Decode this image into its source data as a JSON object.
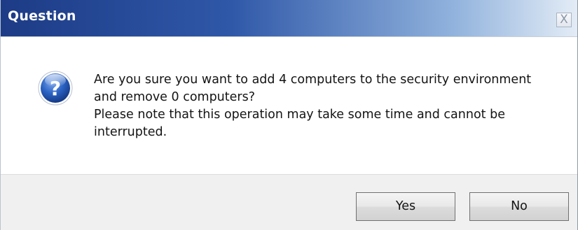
{
  "window": {
    "title": "Question",
    "close_label": "X"
  },
  "message": {
    "line1": "Are you sure you want to add 4 computers to the security environment and remove 0 computers?",
    "line2": "Please note that this operation may take some time and cannot be interrupted."
  },
  "buttons": {
    "yes_label": "Yes",
    "no_label": "No"
  },
  "icon": {
    "type": "question-icon",
    "glyph": "?",
    "color": "#2b63c4"
  }
}
